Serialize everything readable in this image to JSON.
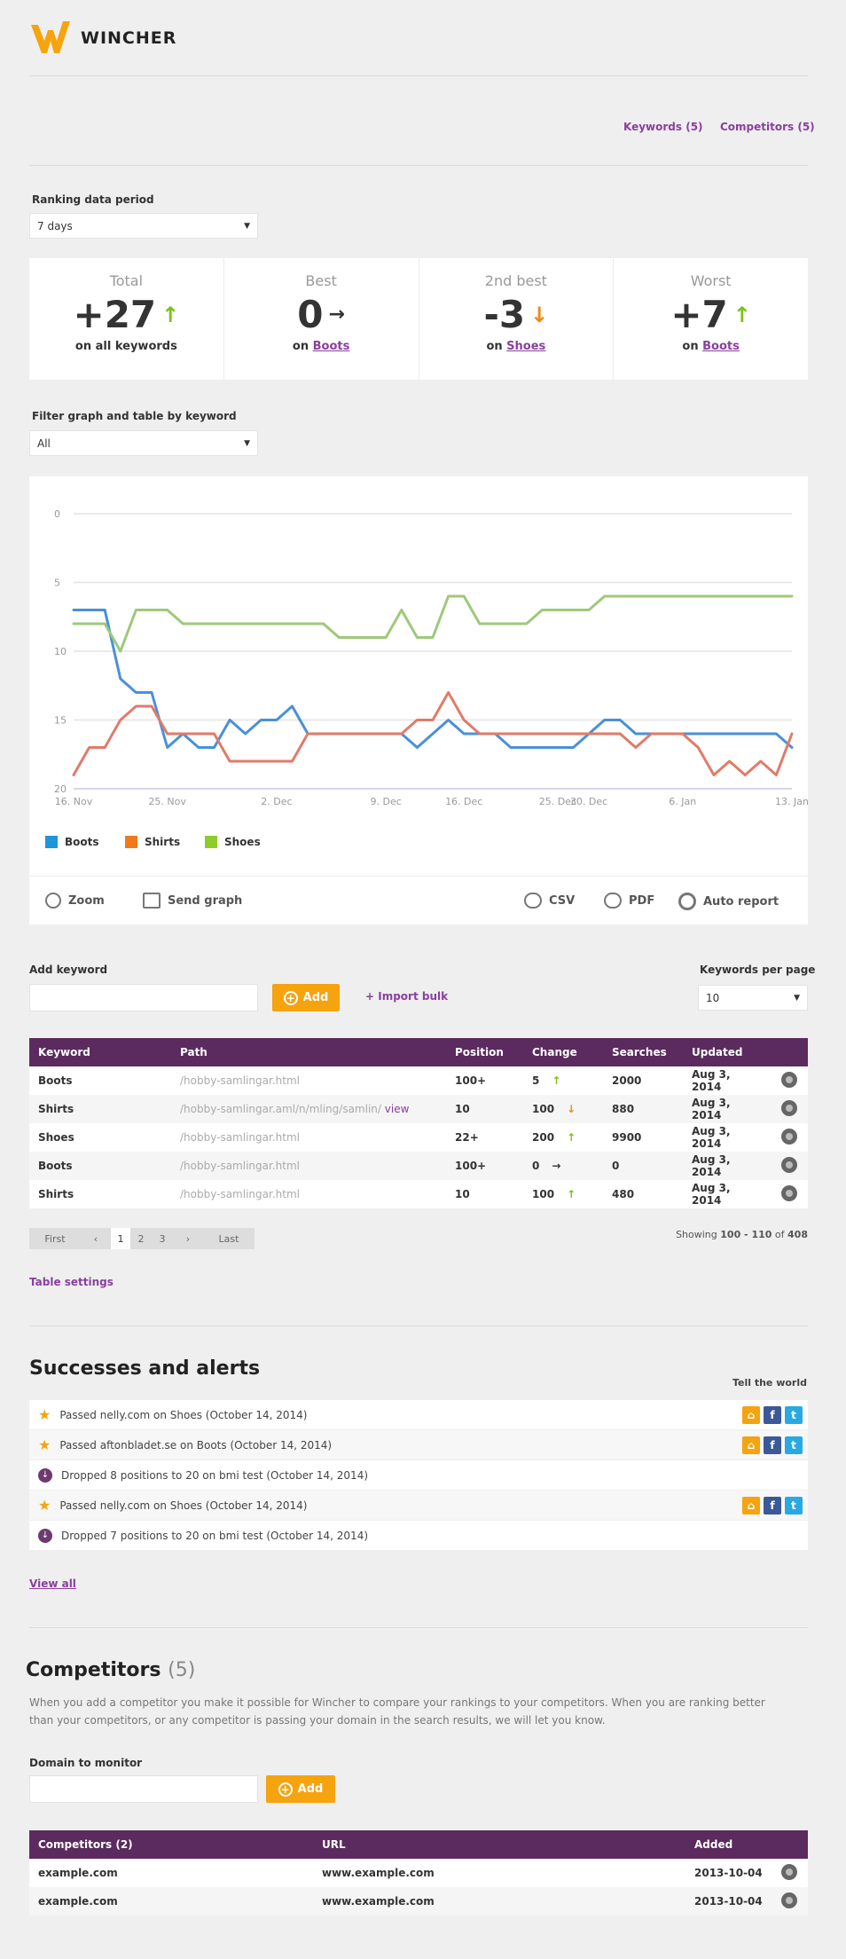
{
  "brand": {
    "name": "WINCHER",
    "color": "#f5a30f"
  },
  "topnav": {
    "keywords": "Keywords (5)",
    "competitors": "Competitors (5)"
  },
  "period": {
    "label": "Ranking data period",
    "value": "7 days"
  },
  "stats": [
    {
      "title": "Total",
      "value": "+27",
      "dir": "up",
      "sub_prefix": "on all keywords",
      "sub_link": ""
    },
    {
      "title": "Best",
      "value": "0",
      "dir": "right",
      "sub_prefix": "on",
      "sub_link": "Boots"
    },
    {
      "title": "2nd best",
      "value": "-3",
      "dir": "down",
      "sub_prefix": "on",
      "sub_link": "Shoes"
    },
    {
      "title": "Worst",
      "value": "+7",
      "dir": "up",
      "sub_prefix": "on",
      "sub_link": "Boots"
    }
  ],
  "filter": {
    "label": "Filter graph and table by keyword",
    "value": "All"
  },
  "chart_data": {
    "type": "line",
    "ylim": [
      20,
      0
    ],
    "yticks": [
      "0",
      "5",
      "10",
      "15",
      "20"
    ],
    "x": [
      "16. Nov",
      "18. Nov",
      "20. Nov",
      "21. Nov",
      "22. Nov",
      "23. Nov",
      "25. Nov",
      "26. Nov",
      "27. Nov",
      "28. Nov",
      "29. Nov",
      "30. Nov",
      "1. Dec",
      "2. Dec",
      "3. Dec",
      "4. Dec",
      "5. Dec",
      "6. Dec",
      "7. Dec",
      "8. Dec",
      "9. Dec",
      "11. Dec",
      "13. Dec",
      "14. Dec",
      "15. Dec",
      "16. Dec",
      "17. Dec",
      "18. Dec",
      "19. Dec",
      "20. Dec",
      "22. Dec",
      "25. Dec",
      "27. Dec",
      "30. Dec",
      "1. Jan",
      "2. Jan",
      "3. Jan",
      "4. Jan",
      "5. Jan",
      "6. Jan",
      "7. Jan",
      "8. Jan",
      "9. Jan",
      "10. Jan",
      "11. Jan",
      "12. Jan",
      "13. Jan"
    ],
    "xticks": [
      "16. Nov",
      "25. Nov",
      "2. Dec",
      "9. Dec",
      "16. Dec",
      "25. Dec",
      "30. Dec",
      "6. Jan",
      "13. Jan"
    ],
    "series": [
      {
        "name": "Boots",
        "color": "#4a90d9",
        "values": [
          7,
          7,
          7,
          12,
          13,
          13,
          17,
          16,
          17,
          17,
          15,
          16,
          15,
          15,
          14,
          16,
          16,
          16,
          16,
          16,
          16,
          16,
          17,
          16,
          15,
          16,
          16,
          16,
          17,
          17,
          17,
          17,
          17,
          16,
          15,
          15,
          16,
          16,
          16,
          16,
          16,
          16,
          16,
          16,
          16,
          16,
          17
        ]
      },
      {
        "name": "Shirts",
        "color": "#e07b6a",
        "values": [
          19,
          17,
          17,
          15,
          14,
          14,
          16,
          16,
          16,
          16,
          18,
          18,
          18,
          18,
          18,
          16,
          16,
          16,
          16,
          16,
          16,
          16,
          15,
          15,
          13,
          15,
          16,
          16,
          16,
          16,
          16,
          16,
          16,
          16,
          16,
          16,
          17,
          16,
          16,
          16,
          17,
          19,
          18,
          19,
          18,
          19,
          16
        ]
      },
      {
        "name": "Shoes",
        "color": "#9ec97a",
        "values": [
          8,
          8,
          8,
          10,
          7,
          7,
          7,
          8,
          8,
          8,
          8,
          8,
          8,
          8,
          8,
          8,
          8,
          9,
          9,
          9,
          9,
          7,
          9,
          9,
          6,
          6,
          8,
          8,
          8,
          8,
          7,
          7,
          7,
          7,
          6,
          6,
          6,
          6,
          6,
          6,
          6,
          6,
          6,
          6,
          6,
          6,
          6
        ]
      }
    ],
    "legend": "bottom-left",
    "grid": true
  },
  "chart_tools": {
    "zoom": "Zoom",
    "send": "Send graph",
    "csv": "CSV",
    "pdf": "PDF",
    "auto": "Auto report"
  },
  "add_keyword": {
    "label": "Add keyword",
    "button": "Add",
    "import": "+ Import bulk"
  },
  "per_page": {
    "label": "Keywords per page",
    "value": "10"
  },
  "keyword_table": {
    "headers": [
      "Keyword",
      "Path",
      "Position",
      "Change",
      "Searches",
      "Updated"
    ],
    "rows": [
      {
        "keyword": "Boots",
        "path": "/hobby-samlingar.html",
        "path_link": "",
        "position": "100+",
        "change": "5",
        "dir": "up",
        "searches": "2000",
        "updated": "Aug 3, 2014"
      },
      {
        "keyword": "Shirts",
        "path": "/hobby-samlingar.aml/n/mling/samlin/",
        "path_link": "view",
        "position": "10",
        "change": "100",
        "dir": "down",
        "searches": "880",
        "updated": "Aug 3, 2014"
      },
      {
        "keyword": "Shoes",
        "path": "/hobby-samlingar.html",
        "path_link": "",
        "position": "22+",
        "change": "200",
        "dir": "up",
        "searches": "9900",
        "updated": "Aug 3, 2014"
      },
      {
        "keyword": "Boots",
        "path": "/hobby-samlingar.html",
        "path_link": "",
        "position": "100+",
        "change": "0",
        "dir": "right",
        "searches": "0",
        "updated": "Aug 3, 2014"
      },
      {
        "keyword": "Shirts",
        "path": "/hobby-samlingar.html",
        "path_link": "",
        "position": "10",
        "change": "100",
        "dir": "up",
        "searches": "480",
        "updated": "Aug 3, 2014"
      }
    ]
  },
  "pager": {
    "first": "First",
    "prev": "‹",
    "pages": [
      "1",
      "2",
      "3"
    ],
    "next": "›",
    "last": "Last",
    "showing_prefix": "Showing",
    "showing_range": "100 - 110",
    "showing_of": "of",
    "showing_total": "408"
  },
  "table_settings": "Table settings",
  "alerts": {
    "title": "Successes and alerts",
    "tell": "Tell the world",
    "items": [
      {
        "type": "star",
        "text": "Passed nelly.com on Shoes (October 14, 2014)",
        "social": true
      },
      {
        "type": "star",
        "text": "Passed aftonbladet.se on Boots (October 14, 2014)",
        "social": true
      },
      {
        "type": "drop",
        "text": "Dropped 8 positions to 20 on bmi test (October 14, 2014)",
        "social": false
      },
      {
        "type": "star",
        "text": "Passed nelly.com on Shoes (October 14, 2014)",
        "social": true
      },
      {
        "type": "drop",
        "text": "Dropped 7 positions to 20 on bmi test (October 14, 2014)",
        "social": false
      }
    ],
    "view_all": "View all"
  },
  "competitors": {
    "title": "Competitors",
    "count": "(5)",
    "description": "When you add a competitor you make it possible for Wincher to compare your rankings to your competitors. When you are ranking better than your competitors, or any competitor is passing your domain in the search results, we will let you know.",
    "domain_label": "Domain to monitor",
    "button": "Add",
    "headers": [
      "Competitors (2)",
      "URL",
      "Added"
    ],
    "rows": [
      {
        "name": "example.com",
        "url": "www.example.com",
        "added": "2013-10-04"
      },
      {
        "name": "example.com",
        "url": "www.example.com",
        "added": "2013-10-04"
      }
    ]
  }
}
